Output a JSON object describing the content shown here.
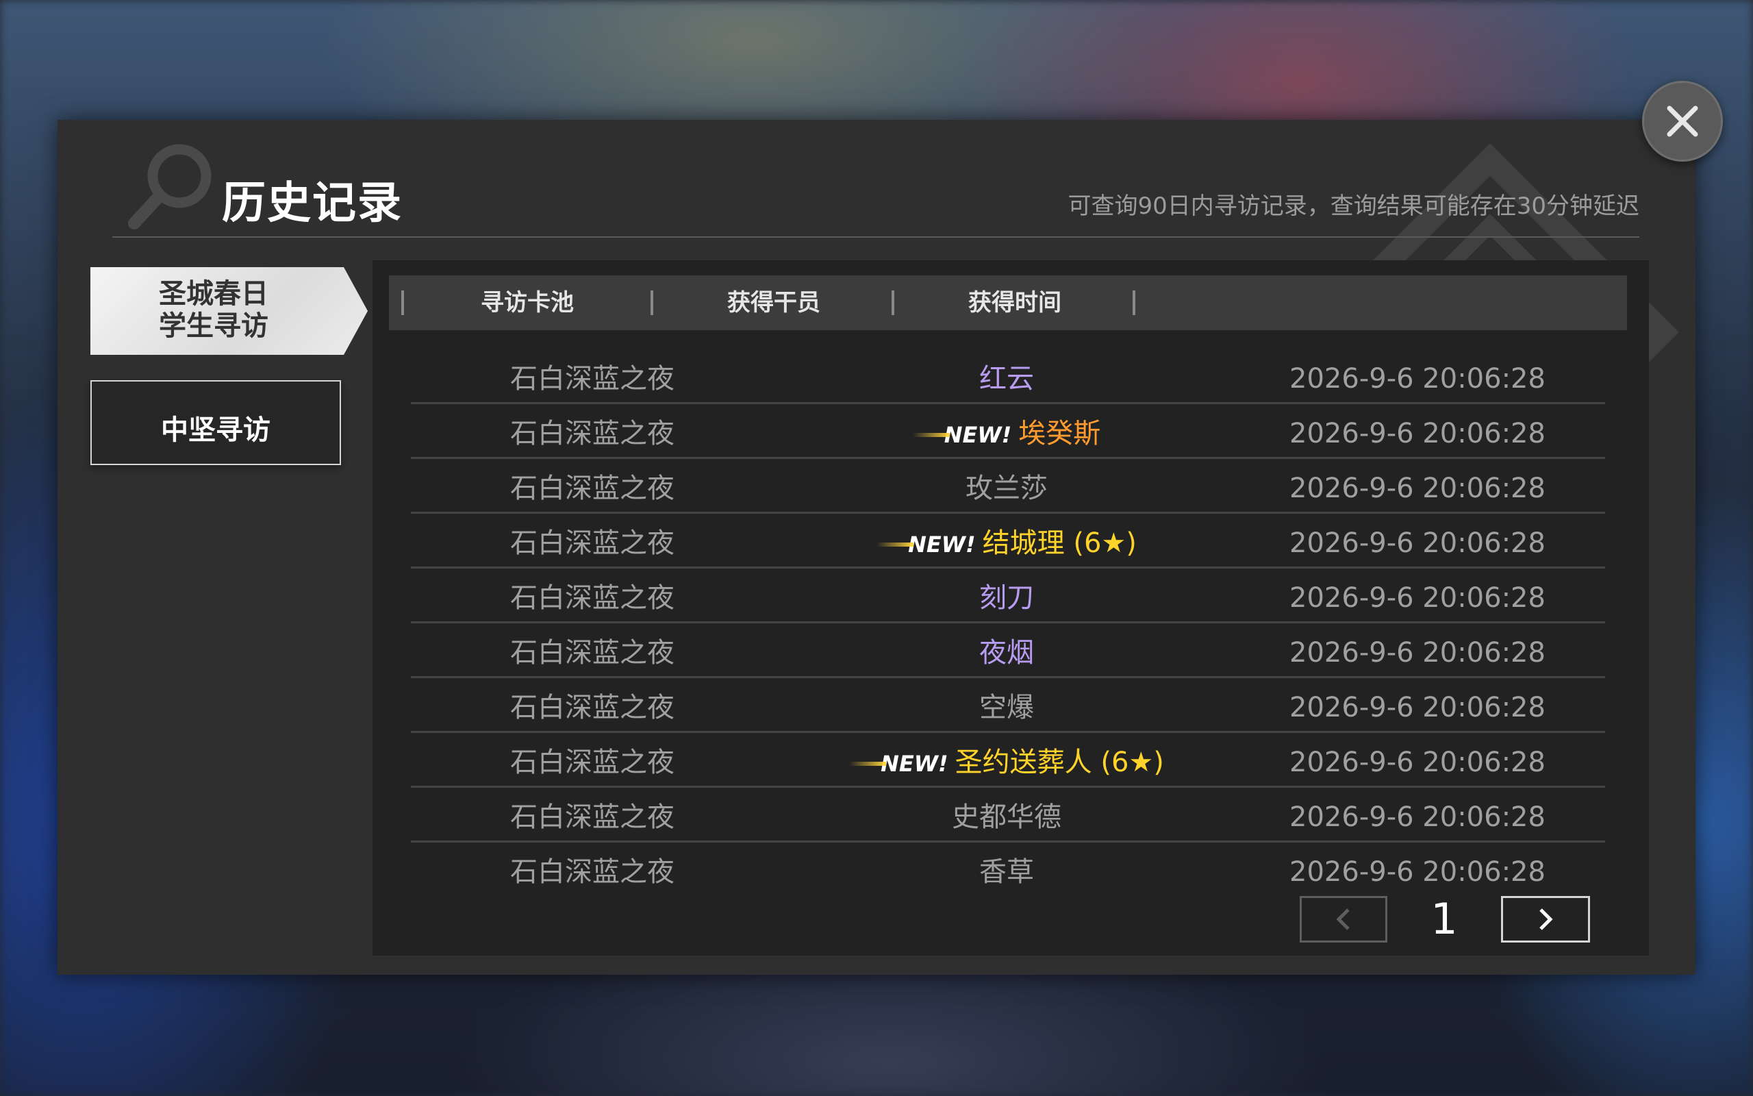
{
  "header": {
    "title": "历史记录",
    "subtitle": "可查询90日内寻访记录，查询结果可能存在30分钟延迟"
  },
  "tabs": [
    {
      "label": "圣城春日\n学生寻访",
      "line1": "圣城春日",
      "line2": "学生寻访",
      "active": true
    },
    {
      "label": "中坚寻访",
      "active": false
    }
  ],
  "table": {
    "columns": [
      "寻访卡池",
      "获得干员",
      "获得时间"
    ],
    "rows": [
      {
        "pool": "石白深蓝之夜",
        "name": "红云",
        "rarity": "r5",
        "is_new": false,
        "time": "2026-9-6 20:06:28"
      },
      {
        "pool": "石白深蓝之夜",
        "name": "埃癸斯",
        "rarity": "r5new",
        "is_new": true,
        "time": "2026-9-6 20:06:28"
      },
      {
        "pool": "石白深蓝之夜",
        "name": "玫兰莎",
        "rarity": "r4",
        "is_new": false,
        "time": "2026-9-6 20:06:28"
      },
      {
        "pool": "石白深蓝之夜",
        "name": "结城理 (6★)",
        "rarity": "r6",
        "is_new": true,
        "time": "2026-9-6 20:06:28"
      },
      {
        "pool": "石白深蓝之夜",
        "name": "刻刀",
        "rarity": "r5",
        "is_new": false,
        "time": "2026-9-6 20:06:28"
      },
      {
        "pool": "石白深蓝之夜",
        "name": "夜烟",
        "rarity": "r5",
        "is_new": false,
        "time": "2026-9-6 20:06:28"
      },
      {
        "pool": "石白深蓝之夜",
        "name": "空爆",
        "rarity": "r4",
        "is_new": false,
        "time": "2026-9-6 20:06:28"
      },
      {
        "pool": "石白深蓝之夜",
        "name": "圣约送葬人 (6★)",
        "rarity": "r6",
        "is_new": true,
        "time": "2026-9-6 20:06:28"
      },
      {
        "pool": "石白深蓝之夜",
        "name": "史都华德",
        "rarity": "r4",
        "is_new": false,
        "time": "2026-9-6 20:06:28"
      },
      {
        "pool": "石白深蓝之夜",
        "name": "香草",
        "rarity": "r4",
        "is_new": false,
        "time": "2026-9-6 20:06:28"
      }
    ],
    "new_tag": "NEW!"
  },
  "pagination": {
    "current_page": "1"
  },
  "icons": {
    "close": "close-icon",
    "prev": "chevron-left-icon",
    "next": "chevron-right-icon",
    "search": "search-icon"
  },
  "colors": {
    "rarity5": "#b89cf0",
    "rarity6": "#ffd42a",
    "rarity5_new": "#ff9b2f",
    "rarity4": "#a0a0a0",
    "modal_bg": "#2f2f2f"
  }
}
